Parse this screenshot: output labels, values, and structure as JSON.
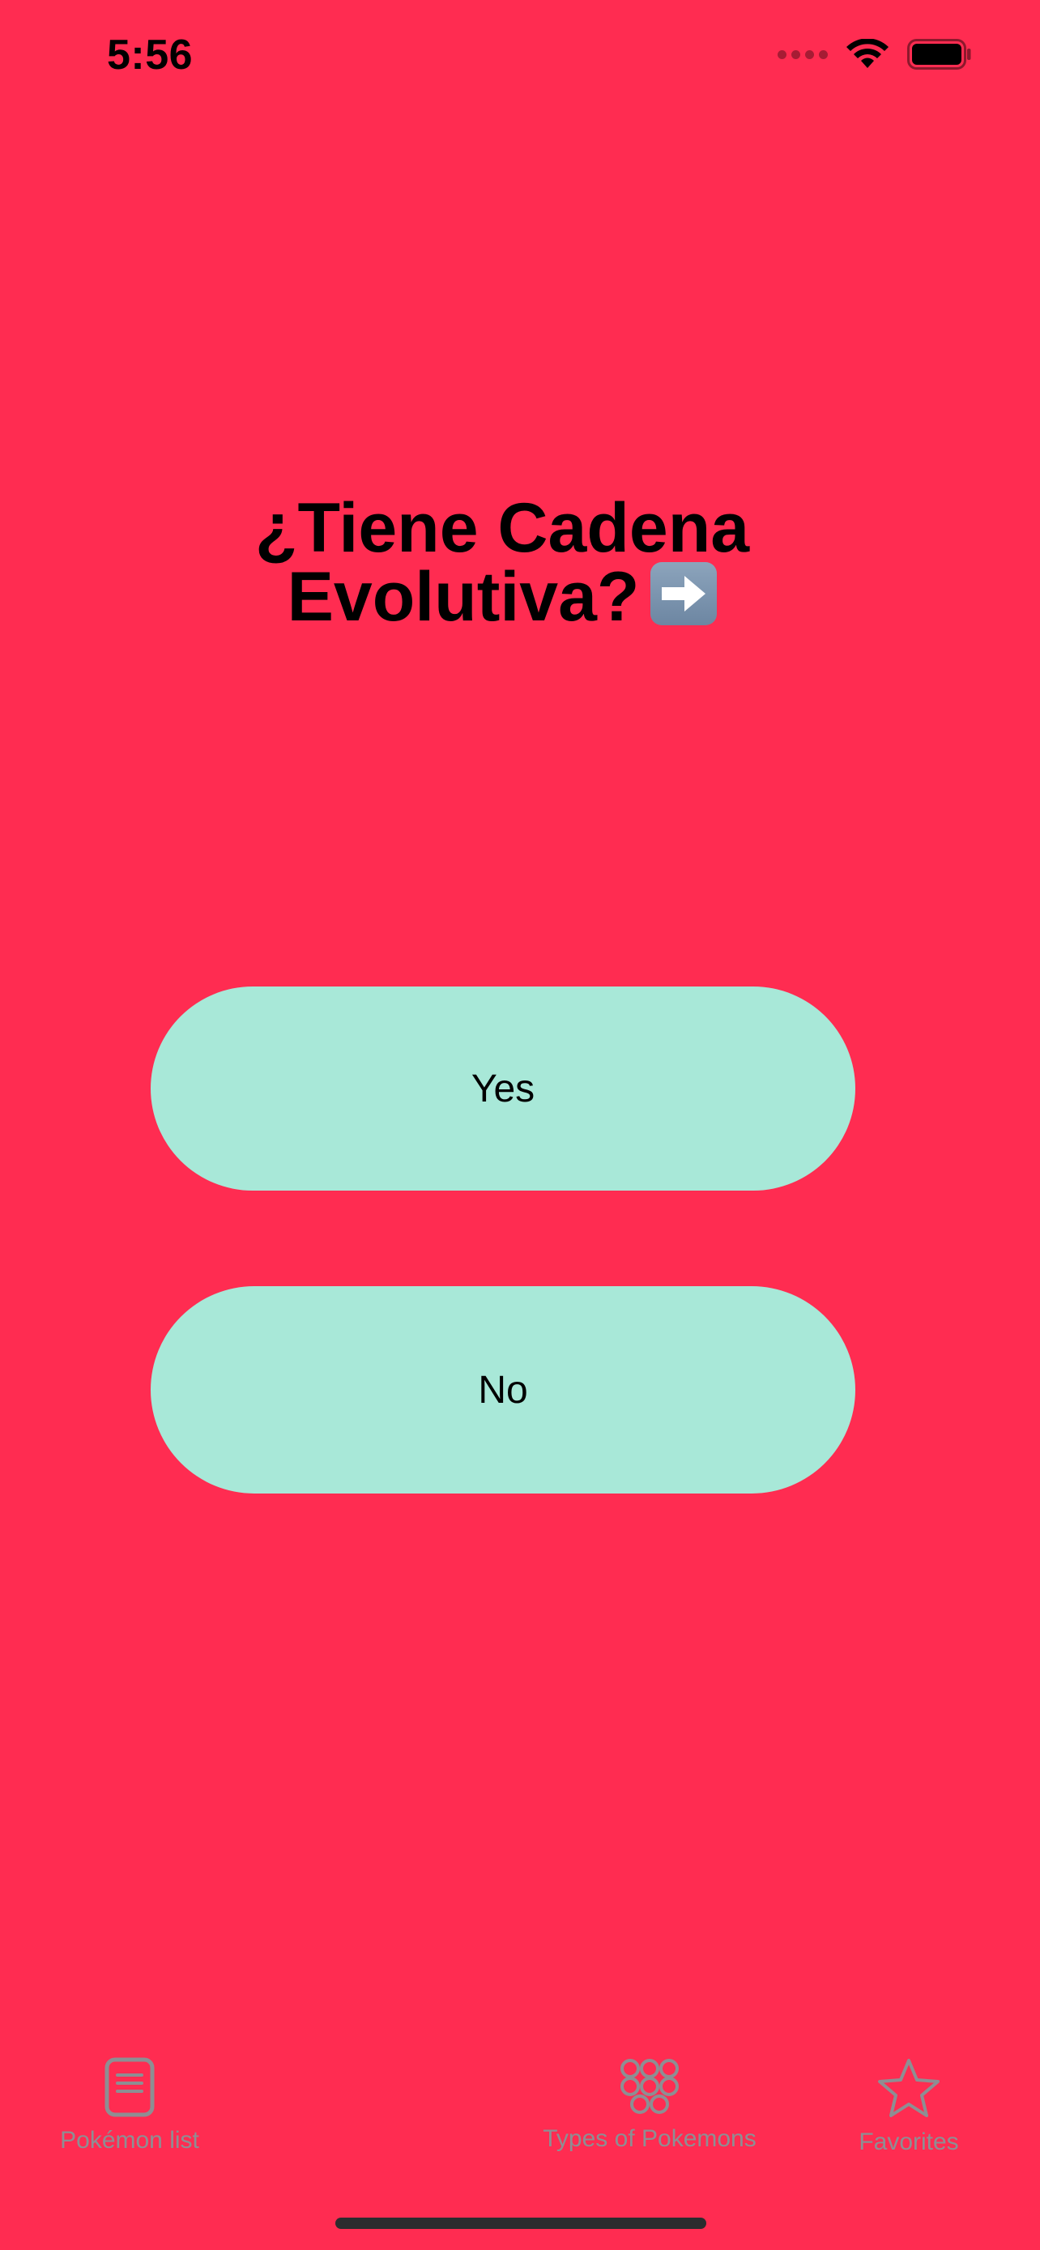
{
  "status_bar": {
    "time": "5:56"
  },
  "question": {
    "line1": "¿Tiene Cadena",
    "line2": "Evolutiva?",
    "emoji_icon": "right-arrow-emoji-icon"
  },
  "buttons": {
    "yes_label": "Yes",
    "no_label": "No"
  },
  "tab_bar": {
    "items": [
      {
        "label": "Pokémon list",
        "icon": "list-document-icon"
      },
      {
        "label": "Types of Pokemons",
        "icon": "circle-grid-icon"
      },
      {
        "label": "Favorites",
        "icon": "star-icon"
      }
    ]
  },
  "colors": {
    "background": "#FF2C51",
    "button": "#A8E8D8",
    "tab_inactive": "#8E8E93"
  }
}
